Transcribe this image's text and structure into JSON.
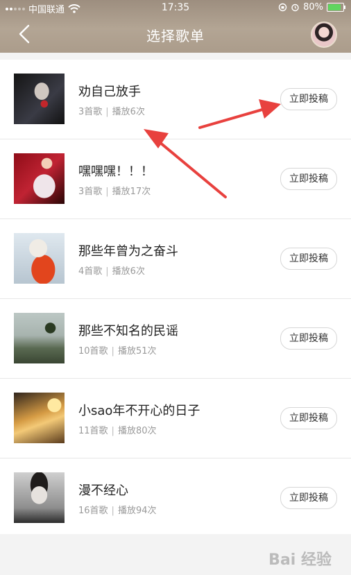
{
  "status_bar": {
    "carrier": "中国联通",
    "time": "17:35",
    "battery": "80%"
  },
  "nav": {
    "title": "选择歌单"
  },
  "playlists": [
    {
      "name": "劝自己放手",
      "songs": "3首歌",
      "plays": "播放6次",
      "button": "立即投稿"
    },
    {
      "name": "嘿嘿嘿！！！",
      "songs": "3首歌",
      "plays": "播放17次",
      "button": "立即投稿"
    },
    {
      "name": "那些年曾为之奋斗",
      "songs": "4首歌",
      "plays": "播放6次",
      "button": "立即投稿"
    },
    {
      "name": "那些不知名的民谣",
      "songs": "10首歌",
      "plays": "播放51次",
      "button": "立即投稿"
    },
    {
      "name": "小sao年不开心的日子",
      "songs": "11首歌",
      "plays": "播放80次",
      "button": "立即投稿"
    },
    {
      "name": "漫不经心",
      "songs": "16首歌",
      "plays": "播放94次",
      "button": "立即投稿"
    }
  ],
  "meta_separator": "|",
  "watermark": "Bai 经验",
  "colors": {
    "header": "#b3a594",
    "annotation_arrow": "#e8413e",
    "battery_fill": "#5fd55f"
  }
}
